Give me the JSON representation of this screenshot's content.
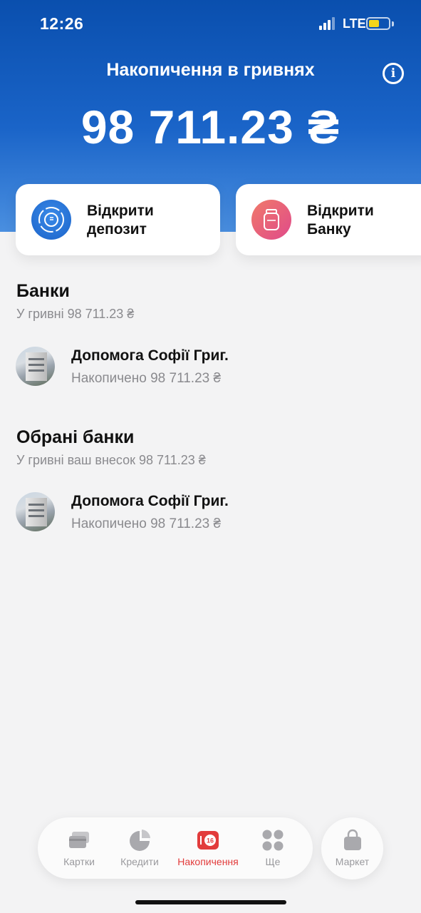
{
  "status_bar": {
    "time": "12:26",
    "network": "LTE"
  },
  "header": {
    "title": "Накопичення в гривнях",
    "balance": "98 711.23 ₴"
  },
  "actions": [
    {
      "label": "Відкрити\nдепозит",
      "icon": "deposit-icon"
    },
    {
      "label": "Відкрити\nБанку",
      "icon": "jar-icon"
    }
  ],
  "banks_section": {
    "title": "Банки",
    "subtitle": "У гривні 98 711.23 ₴",
    "items": [
      {
        "name": "Допомога Софії Григ.",
        "accumulated": "Накопичено 98 711.23 ₴"
      }
    ]
  },
  "favorites_section": {
    "title": "Обрані банки",
    "subtitle": "У гривні ваш внесок 98 711.23 ₴",
    "items": [
      {
        "name": "Допомога Софії Григ.",
        "accumulated": "Накопичено 98 711.23 ₴"
      }
    ]
  },
  "tabbar": {
    "tabs": [
      {
        "label": "Картки",
        "icon": "cards-icon",
        "active": false
      },
      {
        "label": "Кредити",
        "icon": "pie-chart-icon",
        "active": false
      },
      {
        "label": "Накопичення",
        "icon": "savings-icon",
        "badge": "16",
        "active": true
      },
      {
        "label": "Ще",
        "icon": "grid-icon",
        "active": false
      }
    ],
    "market_label": "Маркет"
  },
  "colors": {
    "header_top": "#0a4fae",
    "header_bottom": "#4a8fe0",
    "active_tab": "#e23b3b",
    "battery": "#f5d51b"
  }
}
